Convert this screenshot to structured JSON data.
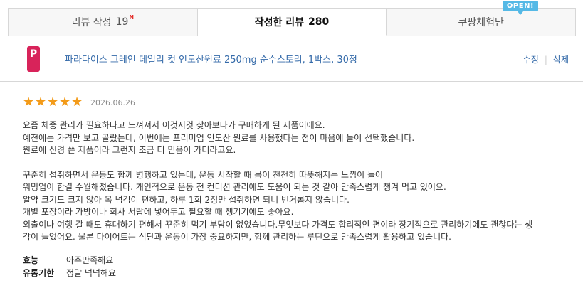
{
  "tabs": [
    {
      "label": "리뷰 작성",
      "count": "19",
      "badge": "N"
    },
    {
      "label": "작성한 리뷰",
      "count": "280"
    },
    {
      "label": "쿠팡체험단",
      "badge": "OPEN!"
    }
  ],
  "product": {
    "name": "파라다이스 그레인 데일리 컷 인도산원료 250mg 순수스토리, 1박스, 30정",
    "thumb_letter": "P",
    "edit_label": "수정",
    "delete_label": "삭제"
  },
  "review": {
    "rating": 5,
    "date": "2026.06.26",
    "paragraphs": [
      [
        "요즘 체중 관리가 필요하다고 느껴져서 이것저것 찾아보다가 구매하게 된 제품이에요.",
        "예전에는 가격만 보고 골랐는데, 이번에는 프리미엄 인도산 원료를 사용했다는 점이 마음에 들어 선택했습니다.",
        "원료에 신경 쓴 제품이라 그런지 조금 더 믿음이 가더라고요."
      ],
      [
        "꾸준히 섭취하면서 운동도 함께 병행하고 있는데, 운동 시작할 때 몸이 천천히 따뜻해지는 느낌이 들어",
        "워밍업이 한결 수월해졌습니다. 개인적으로 운동 전 컨디션 관리에도 도움이 되는 것 같아 만족스럽게 챙겨 먹고 있어요.",
        "알약 크기도 크지 않아 목 넘김이 편하고, 하루 1회 2정만 섭취하면 되니 번거롭지 않습니다.",
        "개별 포장이라 가방이나 회사 서랍에 넣어두고 필요할 때 챙기기에도 좋아요.",
        "외출이나 여행 갈 때도 휴대하기 편해서 꾸준히 먹기 부담이 없었습니다.무엇보다 가격도 합리적인 편이라 장기적으로 관리하기에도 괜찮다는 생",
        "각이 들었어요. 물론 다이어트는 식단과 운동이 가장 중요하지만, 함께 관리하는 루틴으로 만족스럽게 활용하고 있습니다."
      ]
    ],
    "attributes": [
      {
        "label": "효능",
        "value": "아주만족해요"
      },
      {
        "label": "유통기한",
        "value": "정말 넉넉해요"
      }
    ]
  },
  "colors": {
    "star": "#f39b19",
    "link": "#346aa9",
    "badge": "#55b9e6",
    "new": "#e4312d"
  }
}
